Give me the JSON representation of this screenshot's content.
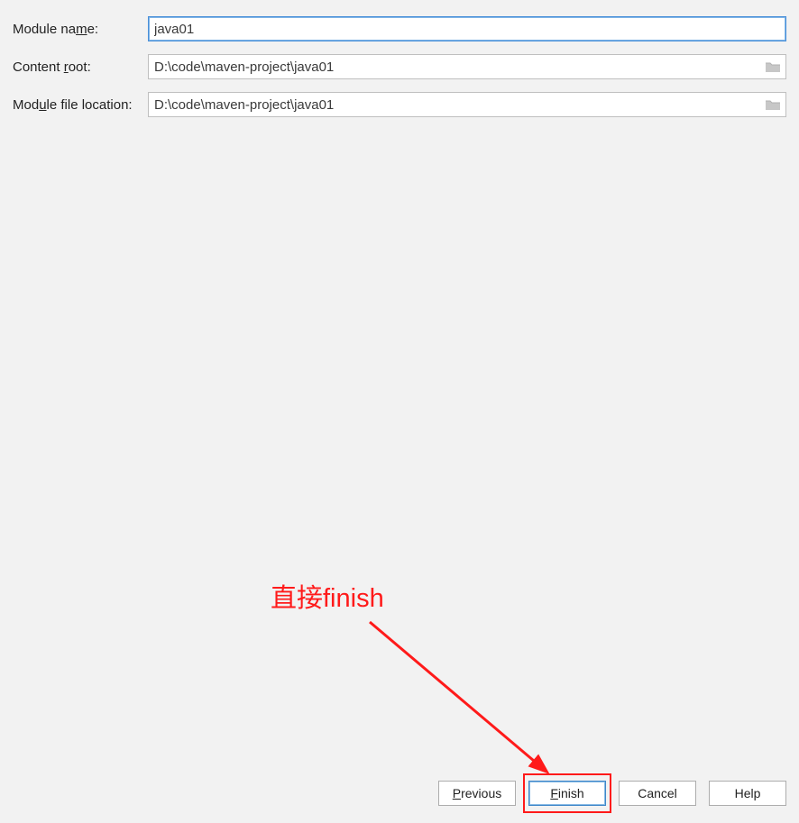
{
  "form": {
    "module_name": {
      "label_pre": "Module na",
      "label_u": "m",
      "label_post": "e:",
      "value": "java01"
    },
    "content_root": {
      "label_pre": "Content ",
      "label_u": "r",
      "label_post": "oot:",
      "value": "D:\\code\\maven-project\\java01"
    },
    "module_file_location": {
      "label_pre": "Mod",
      "label_u": "u",
      "label_post": "le file location:",
      "value": "D:\\code\\maven-project\\java01"
    }
  },
  "buttons": {
    "previous": {
      "u": "P",
      "rest": "revious"
    },
    "finish": {
      "u": "F",
      "rest": "inish"
    },
    "cancel": "Cancel",
    "help": "Help"
  },
  "annotation": {
    "text": "直接finish"
  }
}
